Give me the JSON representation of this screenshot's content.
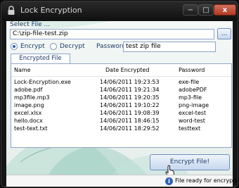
{
  "window": {
    "title": "Lock Encryption",
    "minimize_icon": "−",
    "maximize_icon": "□",
    "close_icon": "x"
  },
  "file": {
    "label": "Select File ...",
    "value": "C:\\zip-file-test.zip",
    "browse_label": "..."
  },
  "mode": {
    "encrypt_label": "Encrypt",
    "decrypt_label": "Decrypt",
    "selected": "encrypt"
  },
  "password": {
    "label": "Password",
    "value": "test zip file"
  },
  "history": {
    "tab_label": "Encrypted File History",
    "columns": [
      "Name",
      "Date Encrypted",
      "Password"
    ],
    "rows": [
      [
        "Lock-Encryption.exe",
        "14/06/2011 19:23:53",
        "exe-file"
      ],
      [
        "adobe.pdf",
        "14/06/2011 19:21:34",
        "adobePDF"
      ],
      [
        "mp3file.mp3",
        "14/06/2011 19:20:35",
        "mp3-file"
      ],
      [
        "image.png",
        "14/06/2011 19:10:22",
        "png-image"
      ],
      [
        "excel.xlsx",
        "14/06/2011 19:08:39",
        "excel-test"
      ],
      [
        "hello.docx",
        "14/06/2011 18:46:15",
        "word-test"
      ],
      [
        "test-text.txt",
        "14/06/2011 18:29:52",
        "testtext"
      ]
    ]
  },
  "actions": {
    "encrypt_button": "Encrypt File!"
  },
  "status": {
    "icon": "info-icon",
    "text": "File ready for encryption"
  },
  "colors": {
    "accent": "#1e3b69",
    "background": "#e6efec",
    "close": "#b03a24"
  }
}
